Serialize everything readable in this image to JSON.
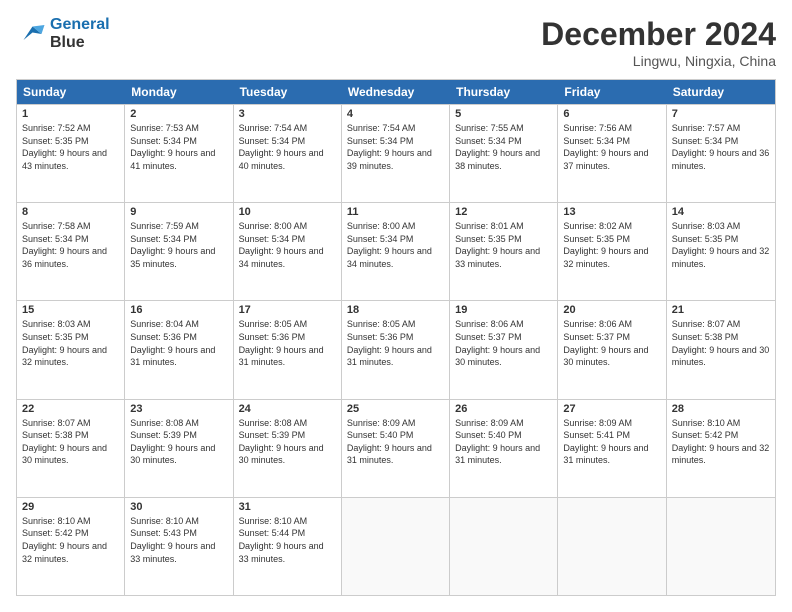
{
  "logo": {
    "line1": "General",
    "line2": "Blue"
  },
  "header": {
    "month": "December 2024",
    "location": "Lingwu, Ningxia, China"
  },
  "weekdays": [
    "Sunday",
    "Monday",
    "Tuesday",
    "Wednesday",
    "Thursday",
    "Friday",
    "Saturday"
  ],
  "weeks": [
    [
      {
        "day": "1",
        "sunrise": "Sunrise: 7:52 AM",
        "sunset": "Sunset: 5:35 PM",
        "daylight": "Daylight: 9 hours and 43 minutes."
      },
      {
        "day": "2",
        "sunrise": "Sunrise: 7:53 AM",
        "sunset": "Sunset: 5:34 PM",
        "daylight": "Daylight: 9 hours and 41 minutes."
      },
      {
        "day": "3",
        "sunrise": "Sunrise: 7:54 AM",
        "sunset": "Sunset: 5:34 PM",
        "daylight": "Daylight: 9 hours and 40 minutes."
      },
      {
        "day": "4",
        "sunrise": "Sunrise: 7:54 AM",
        "sunset": "Sunset: 5:34 PM",
        "daylight": "Daylight: 9 hours and 39 minutes."
      },
      {
        "day": "5",
        "sunrise": "Sunrise: 7:55 AM",
        "sunset": "Sunset: 5:34 PM",
        "daylight": "Daylight: 9 hours and 38 minutes."
      },
      {
        "day": "6",
        "sunrise": "Sunrise: 7:56 AM",
        "sunset": "Sunset: 5:34 PM",
        "daylight": "Daylight: 9 hours and 37 minutes."
      },
      {
        "day": "7",
        "sunrise": "Sunrise: 7:57 AM",
        "sunset": "Sunset: 5:34 PM",
        "daylight": "Daylight: 9 hours and 36 minutes."
      }
    ],
    [
      {
        "day": "8",
        "sunrise": "Sunrise: 7:58 AM",
        "sunset": "Sunset: 5:34 PM",
        "daylight": "Daylight: 9 hours and 36 minutes."
      },
      {
        "day": "9",
        "sunrise": "Sunrise: 7:59 AM",
        "sunset": "Sunset: 5:34 PM",
        "daylight": "Daylight: 9 hours and 35 minutes."
      },
      {
        "day": "10",
        "sunrise": "Sunrise: 8:00 AM",
        "sunset": "Sunset: 5:34 PM",
        "daylight": "Daylight: 9 hours and 34 minutes."
      },
      {
        "day": "11",
        "sunrise": "Sunrise: 8:00 AM",
        "sunset": "Sunset: 5:34 PM",
        "daylight": "Daylight: 9 hours and 34 minutes."
      },
      {
        "day": "12",
        "sunrise": "Sunrise: 8:01 AM",
        "sunset": "Sunset: 5:35 PM",
        "daylight": "Daylight: 9 hours and 33 minutes."
      },
      {
        "day": "13",
        "sunrise": "Sunrise: 8:02 AM",
        "sunset": "Sunset: 5:35 PM",
        "daylight": "Daylight: 9 hours and 32 minutes."
      },
      {
        "day": "14",
        "sunrise": "Sunrise: 8:03 AM",
        "sunset": "Sunset: 5:35 PM",
        "daylight": "Daylight: 9 hours and 32 minutes."
      }
    ],
    [
      {
        "day": "15",
        "sunrise": "Sunrise: 8:03 AM",
        "sunset": "Sunset: 5:35 PM",
        "daylight": "Daylight: 9 hours and 32 minutes."
      },
      {
        "day": "16",
        "sunrise": "Sunrise: 8:04 AM",
        "sunset": "Sunset: 5:36 PM",
        "daylight": "Daylight: 9 hours and 31 minutes."
      },
      {
        "day": "17",
        "sunrise": "Sunrise: 8:05 AM",
        "sunset": "Sunset: 5:36 PM",
        "daylight": "Daylight: 9 hours and 31 minutes."
      },
      {
        "day": "18",
        "sunrise": "Sunrise: 8:05 AM",
        "sunset": "Sunset: 5:36 PM",
        "daylight": "Daylight: 9 hours and 31 minutes."
      },
      {
        "day": "19",
        "sunrise": "Sunrise: 8:06 AM",
        "sunset": "Sunset: 5:37 PM",
        "daylight": "Daylight: 9 hours and 30 minutes."
      },
      {
        "day": "20",
        "sunrise": "Sunrise: 8:06 AM",
        "sunset": "Sunset: 5:37 PM",
        "daylight": "Daylight: 9 hours and 30 minutes."
      },
      {
        "day": "21",
        "sunrise": "Sunrise: 8:07 AM",
        "sunset": "Sunset: 5:38 PM",
        "daylight": "Daylight: 9 hours and 30 minutes."
      }
    ],
    [
      {
        "day": "22",
        "sunrise": "Sunrise: 8:07 AM",
        "sunset": "Sunset: 5:38 PM",
        "daylight": "Daylight: 9 hours and 30 minutes."
      },
      {
        "day": "23",
        "sunrise": "Sunrise: 8:08 AM",
        "sunset": "Sunset: 5:39 PM",
        "daylight": "Daylight: 9 hours and 30 minutes."
      },
      {
        "day": "24",
        "sunrise": "Sunrise: 8:08 AM",
        "sunset": "Sunset: 5:39 PM",
        "daylight": "Daylight: 9 hours and 30 minutes."
      },
      {
        "day": "25",
        "sunrise": "Sunrise: 8:09 AM",
        "sunset": "Sunset: 5:40 PM",
        "daylight": "Daylight: 9 hours and 31 minutes."
      },
      {
        "day": "26",
        "sunrise": "Sunrise: 8:09 AM",
        "sunset": "Sunset: 5:40 PM",
        "daylight": "Daylight: 9 hours and 31 minutes."
      },
      {
        "day": "27",
        "sunrise": "Sunrise: 8:09 AM",
        "sunset": "Sunset: 5:41 PM",
        "daylight": "Daylight: 9 hours and 31 minutes."
      },
      {
        "day": "28",
        "sunrise": "Sunrise: 8:10 AM",
        "sunset": "Sunset: 5:42 PM",
        "daylight": "Daylight: 9 hours and 32 minutes."
      }
    ],
    [
      {
        "day": "29",
        "sunrise": "Sunrise: 8:10 AM",
        "sunset": "Sunset: 5:42 PM",
        "daylight": "Daylight: 9 hours and 32 minutes."
      },
      {
        "day": "30",
        "sunrise": "Sunrise: 8:10 AM",
        "sunset": "Sunset: 5:43 PM",
        "daylight": "Daylight: 9 hours and 33 minutes."
      },
      {
        "day": "31",
        "sunrise": "Sunrise: 8:10 AM",
        "sunset": "Sunset: 5:44 PM",
        "daylight": "Daylight: 9 hours and 33 minutes."
      },
      null,
      null,
      null,
      null
    ]
  ]
}
